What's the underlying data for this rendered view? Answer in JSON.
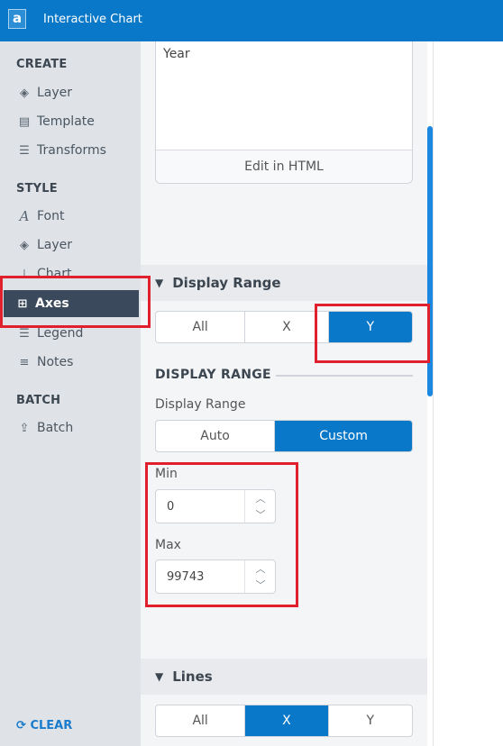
{
  "app": {
    "title": "Interactive Chart",
    "logo_letter": "a"
  },
  "sidebar": {
    "sections": [
      {
        "heading": "CREATE",
        "items": [
          {
            "label": "Layer",
            "icon": "layers-icon"
          },
          {
            "label": "Template",
            "icon": "template-icon"
          },
          {
            "label": "Transforms",
            "icon": "transforms-icon"
          }
        ]
      },
      {
        "heading": "STYLE",
        "items": [
          {
            "label": "Font",
            "icon": "font-icon"
          },
          {
            "label": "Layer",
            "icon": "layers-icon"
          },
          {
            "label": "Chart",
            "icon": "chart-icon"
          },
          {
            "label": "Axes",
            "icon": "axes-icon",
            "active": true
          },
          {
            "label": "Legend",
            "icon": "legend-icon"
          },
          {
            "label": "Notes",
            "icon": "notes-icon"
          }
        ]
      },
      {
        "heading": "BATCH",
        "items": [
          {
            "label": "Batch",
            "icon": "batch-icon"
          }
        ]
      }
    ],
    "clear_label": "CLEAR"
  },
  "panel": {
    "html_box_text": "Year",
    "edit_html_label": "Edit in HTML",
    "display_range_header": "Display Range",
    "axis_tabs": [
      "All",
      "X",
      "Y"
    ],
    "axis_tab_selected": "Y",
    "sub_title": "DISPLAY RANGE",
    "display_range_label": "Display Range",
    "range_modes": [
      "Auto",
      "Custom"
    ],
    "range_mode_selected": "Custom",
    "min_label": "Min",
    "min_value": "0",
    "max_label": "Max",
    "max_value": "99743",
    "lines_header": "Lines",
    "lines_tabs": [
      "All",
      "X",
      "Y"
    ],
    "lines_tab_selected": "X"
  },
  "colors": {
    "accent": "#0a78c8",
    "sidebar_active": "#3a4a5c",
    "highlight": "#e0202c"
  }
}
